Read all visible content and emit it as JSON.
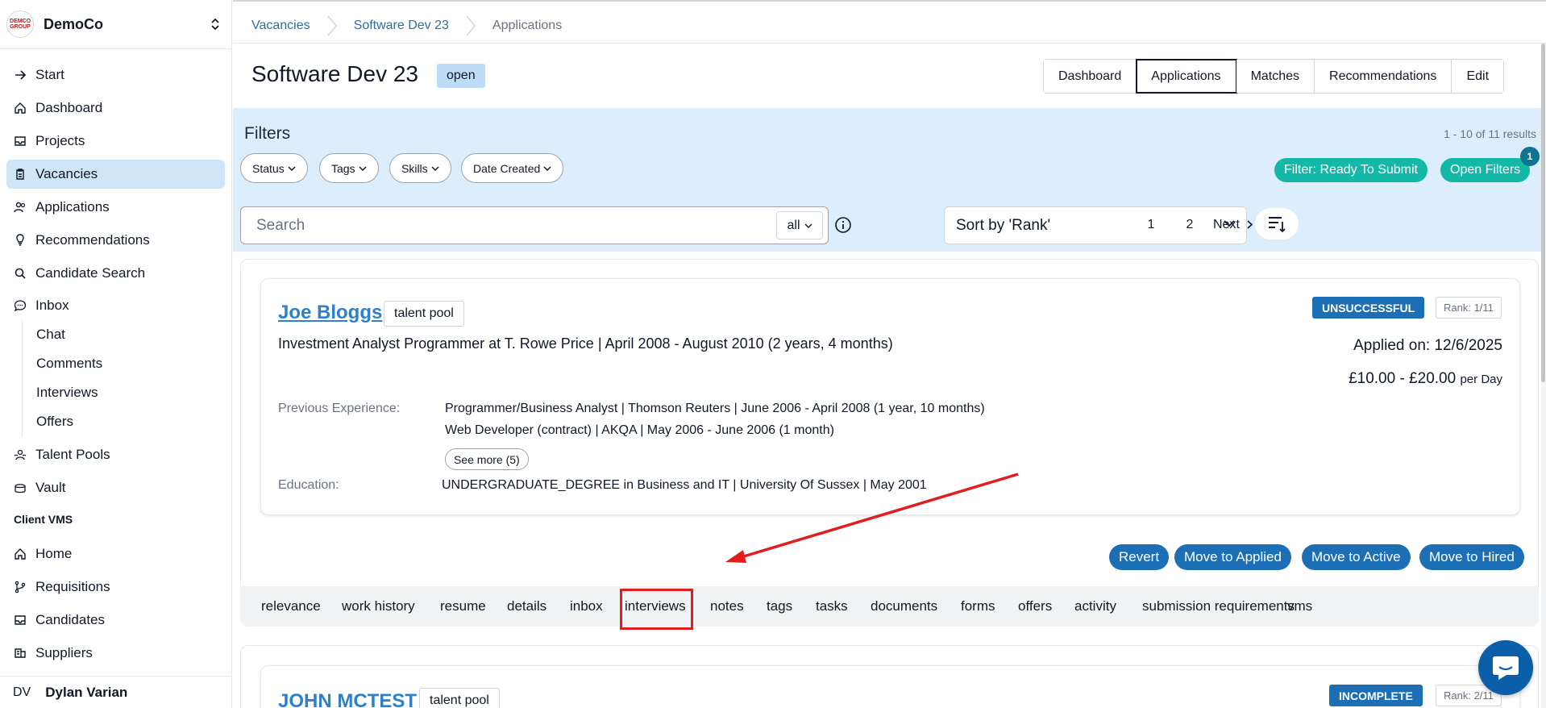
{
  "sidebar": {
    "org_logo_text": "DEMCO GROUP",
    "org_name": "DemoCo",
    "items": [
      {
        "label": "Start",
        "icon": "arrow-right-icon"
      },
      {
        "label": "Dashboard",
        "icon": "home-icon"
      },
      {
        "label": "Projects",
        "icon": "inbox-tray-icon"
      },
      {
        "label": "Vacancies",
        "icon": "clipboard-icon"
      },
      {
        "label": "Applications",
        "icon": "users-icon"
      },
      {
        "label": "Recommendations",
        "icon": "lightbulb-icon"
      },
      {
        "label": "Candidate Search",
        "icon": "search-icon"
      },
      {
        "label": "Inbox",
        "icon": "chat-bubble-icon"
      }
    ],
    "inbox_sub": [
      "Chat",
      "Comments",
      "Interviews",
      "Offers"
    ],
    "items2": [
      {
        "label": "Talent Pools",
        "icon": "talent-pool-icon"
      },
      {
        "label": "Vault",
        "icon": "vault-icon"
      }
    ],
    "section_label": "Client VMS",
    "vms_items": [
      {
        "label": "Home",
        "icon": "home-icon"
      },
      {
        "label": "Requisitions",
        "icon": "git-branch-icon"
      },
      {
        "label": "Candidates",
        "icon": "inbox-tray-icon"
      },
      {
        "label": "Suppliers",
        "icon": "suppliers-icon"
      }
    ],
    "user_initials": "DV",
    "user_name": "Dylan Varian"
  },
  "breadcrumb": [
    "Vacancies",
    "Software Dev 23",
    "Applications"
  ],
  "page": {
    "title": "Software Dev 23",
    "status": "open",
    "view_tabs": [
      "Dashboard",
      "Applications",
      "Matches",
      "Recommendations",
      "Edit"
    ],
    "active_tab": "Applications"
  },
  "filters": {
    "title": "Filters",
    "result_count": "1 - 10 of 11 results",
    "chips": [
      "Status",
      "Tags",
      "Skills",
      "Date Created"
    ],
    "ready_btn": "Filter: Ready To Submit",
    "open_btn": "Open Filters",
    "open_badge": "1",
    "search_placeholder": "Search",
    "search_scope": "all",
    "sort_label": "Sort by 'Rank'",
    "pages": [
      "1",
      "2"
    ],
    "next_label": "Next"
  },
  "cards": [
    {
      "name": "Joe Bloggs",
      "pool_tag": "talent pool",
      "current_role": "Investment Analyst Programmer at T. Rowe Price | April 2008 - August 2010 (2 years, 4 months)",
      "status": "UNSUCCESSFUL",
      "rank": "Rank: 1/11",
      "applied": "Applied on: 12/6/2025",
      "rate": "£10.00 - £20.00",
      "rate_unit": "per Day",
      "prev_exp_label": "Previous Experience:",
      "prev_exp": [
        "Programmer/Business Analyst | Thomson Reuters | June 2006 - April 2008 (1 year, 10 months)",
        "Web Developer (contract) | AKQA | May 2006 - June 2006 (1 month)"
      ],
      "see_more": "See more (5)",
      "edu_label": "Education:",
      "education": "UNDERGRADUATE_DEGREE in Business and IT | University Of Sussex | May 2001",
      "actions": [
        "Revert",
        "Move to Applied",
        "Move to Active",
        "Move to Hired"
      ],
      "subtabs": [
        "relevance",
        "work history",
        "resume",
        "details",
        "inbox",
        "interviews",
        "notes",
        "tags",
        "tasks",
        "documents",
        "forms",
        "offers",
        "activity",
        "submission requirements",
        "vms"
      ]
    },
    {
      "name": "JOHN MCTEST",
      "pool_tag": "talent pool",
      "status": "INCOMPLETE",
      "rank": "Rank: 2/11"
    }
  ],
  "colors": {
    "accent_blue": "#1d6fb5",
    "link_blue": "#2f80c9",
    "teal": "#14b8a6",
    "filter_bg": "#dceefb",
    "active_nav_bg": "#cfe5f8",
    "annotation_red": "#e11d1d"
  },
  "annotation": {
    "highlighted_tab": "interviews",
    "arrow_color": "#e11d1d"
  }
}
